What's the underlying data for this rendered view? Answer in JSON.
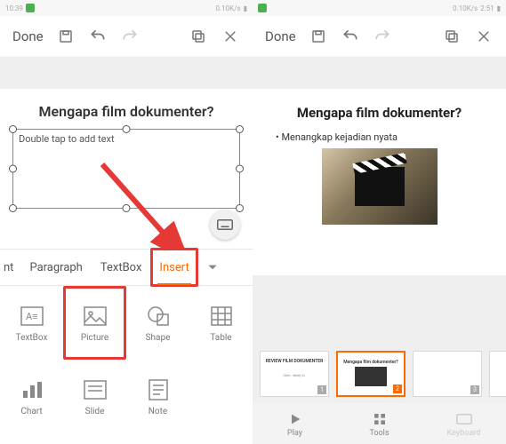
{
  "statusbar": {
    "time_left": "10:39",
    "time_right": "2:51",
    "net": "0.10K/s"
  },
  "toolbar": {
    "done": "Done"
  },
  "left": {
    "slide_title": "Mengapa film dokumenter?",
    "textbox_placeholder": "Double tap to add text",
    "tabs": {
      "cut": "nt",
      "paragraph": "Paragraph",
      "textbox": "TextBox",
      "insert": "Insert"
    },
    "tools": {
      "textbox": "TextBox",
      "picture": "Picture",
      "shape": "Shape",
      "table": "Table",
      "chart": "Chart",
      "slide": "Slide",
      "note": "Note"
    }
  },
  "right": {
    "slide_title": "Mengapa film dokumenter?",
    "bullet1": "•  Menangkap kejadian nyata",
    "thumbs": {
      "t1_title": "REVIEW FILM DOKUMENTER",
      "t2_title": "Mengapa film dokumenter?"
    },
    "bottomnav": {
      "play": "Play",
      "tools": "Tools",
      "keyboard": "Keyboard"
    }
  }
}
